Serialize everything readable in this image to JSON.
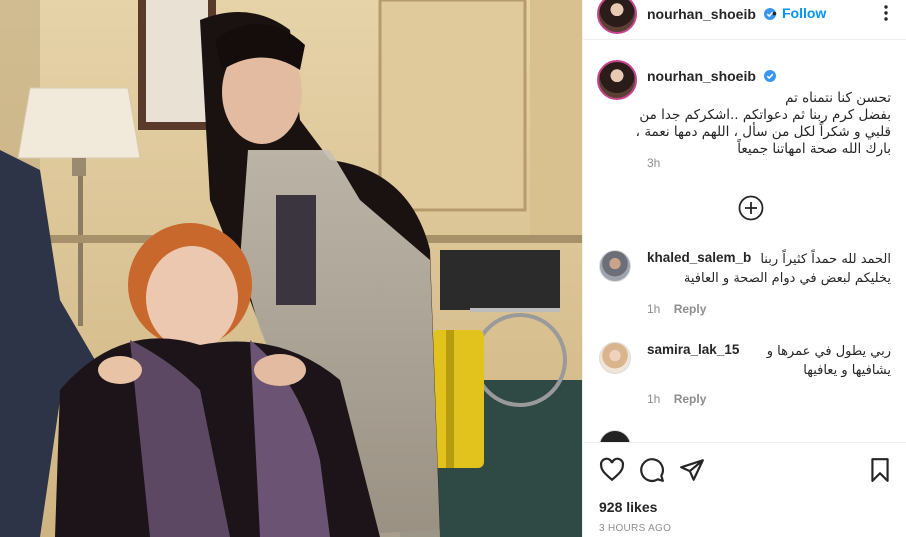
{
  "post": {
    "username": "nourhan_shoeib",
    "follow_label": "Follow",
    "separator": "•",
    "caption": "تحسن كنا نتمناه تم\nبفضل كرم ربنا ثم دعواتكم ..اشكركم جدا من\nقلبي و شكراً لكل من سأل ، اللهم دمها نعمة ،\nبارك الله صحة امهاتنا جميعاً",
    "caption_time": "3h"
  },
  "comments": [
    {
      "username": "khaled_salem_b",
      "text": "الحمد لله حمداً كثيراً ربنا\nيخليكم لبعض في دوام الصحة و العافية",
      "time": "1h",
      "reply_label": "Reply"
    },
    {
      "username": "samira_lak_15",
      "text": "ربي يطول في عمرها و\nيشافيها و يعافيها",
      "time": "1h",
      "reply_label": "Reply"
    }
  ],
  "footer": {
    "likes": "928 likes",
    "posted": "3 HOURS AGO"
  },
  "colors": {
    "accent": "#0095f6",
    "verified": "#3897f0",
    "muted": "#8e8e8e",
    "text": "#262626",
    "divider": "#efefef"
  },
  "icons": [
    "more-options-icon",
    "verified-badge-icon",
    "load-more-comments-icon",
    "heart-icon",
    "comment-icon",
    "share-icon",
    "bookmark-icon"
  ]
}
